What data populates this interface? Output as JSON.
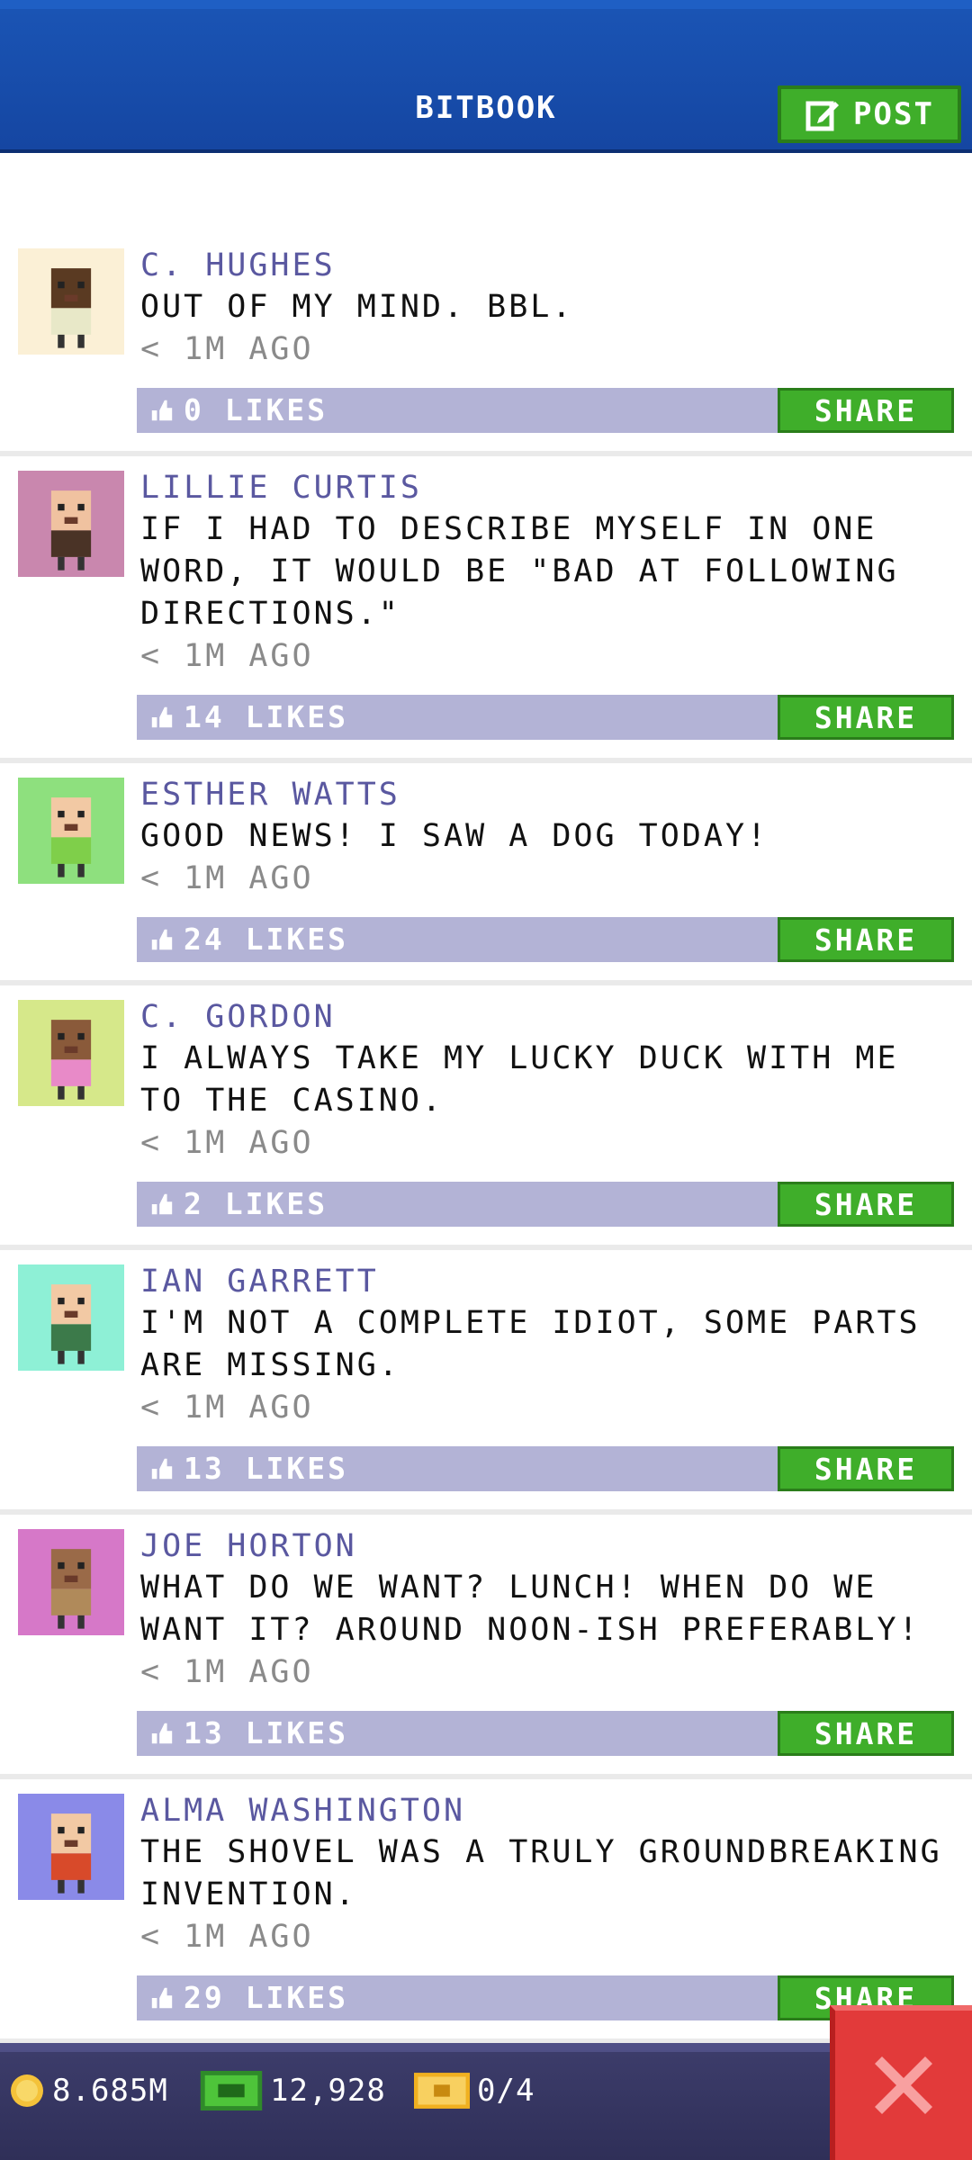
{
  "header": {
    "title": "BITBOOK",
    "post_label": "POST"
  },
  "posts": [
    {
      "author": "C. HUGHES",
      "message": "OUT OF MY MIND. BBL.",
      "time": "< 1M AGO",
      "likes": "0 LIKES",
      "share": "SHARE",
      "avatar_bg": "#fbf0d6",
      "skin": "#5a3a22",
      "shirt": "#e8e8c8"
    },
    {
      "author": "LILLIE CURTIS",
      "message": "IF I HAD TO DESCRIBE MYSELF IN ONE WORD, IT WOULD BE \"BAD AT FOLLOWING DIRECTIONS.\"",
      "time": "< 1M AGO",
      "likes": "14 LIKES",
      "share": "SHARE",
      "avatar_bg": "#c987ae",
      "skin": "#f0c2a0",
      "shirt": "#4a3326"
    },
    {
      "author": "ESTHER WATTS",
      "message": "GOOD NEWS! I SAW A DOG TODAY!",
      "time": "< 1M AGO",
      "likes": "24 LIKES",
      "share": "SHARE",
      "avatar_bg": "#8ee07e",
      "skin": "#f2c9a4",
      "shirt": "#7fcf4a"
    },
    {
      "author": "C. GORDON",
      "message": "I ALWAYS TAKE MY LUCKY DUCK WITH ME TO THE CASINO.",
      "time": "< 1M AGO",
      "likes": "2 LIKES",
      "share": "SHARE",
      "avatar_bg": "#d6e88a",
      "skin": "#8a5a3a",
      "shirt": "#e88ac8"
    },
    {
      "author": "IAN GARRETT",
      "message": "I'M NOT A COMPLETE IDIOT, SOME PARTS ARE MISSING.",
      "time": "< 1M AGO",
      "likes": "13 LIKES",
      "share": "SHARE",
      "avatar_bg": "#8ef0d6",
      "skin": "#f2c9a4",
      "shirt": "#3c7a4a"
    },
    {
      "author": "JOE HORTON",
      "message": "WHAT DO WE WANT? LUNCH! WHEN DO WE WANT IT? AROUND NOON-ISH PREFERABLY!",
      "time": "< 1M AGO",
      "likes": "13 LIKES",
      "share": "SHARE",
      "avatar_bg": "#d678c8",
      "skin": "#9a6a48",
      "shirt": "#b08a5a"
    },
    {
      "author": "ALMA WASHINGTON",
      "message": "THE SHOVEL WAS A TRULY GROUNDBREAKING INVENTION.",
      "time": "< 1M AGO",
      "likes": "29 LIKES",
      "share": "SHARE",
      "avatar_bg": "#8a8ae8",
      "skin": "#f2c9a4",
      "shirt": "#d84a2a"
    }
  ],
  "bottom_bar": {
    "coins": "8.685M",
    "bux": "12,928",
    "tickets": "0/4"
  },
  "colors": {
    "header_blue": "#1a54b4",
    "share_green": "#3fae2a",
    "bar_lavender": "#b3b3d6",
    "close_red": "#e23a3a"
  },
  "icons": {
    "post": "edit-icon",
    "like": "thumbs-up-icon",
    "coin": "coin-icon",
    "bux": "bux-icon",
    "ticket": "ticket-icon",
    "close": "close-icon"
  }
}
